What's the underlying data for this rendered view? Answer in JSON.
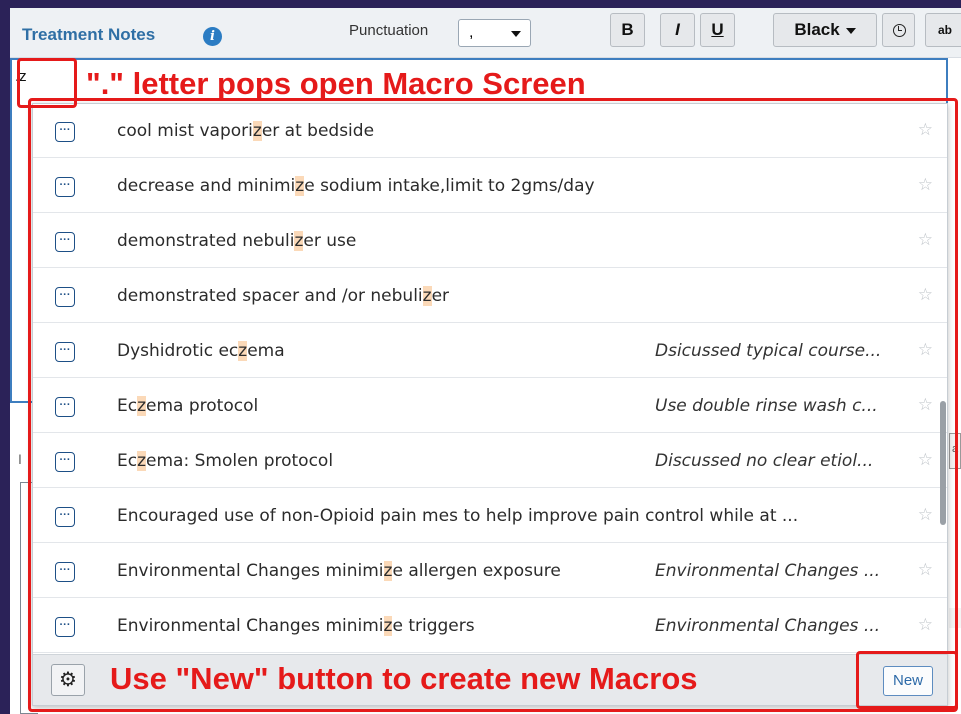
{
  "toolbar": {
    "title": "Treatment Notes",
    "punctuation_label": "Punctuation",
    "punctuation_value": ",",
    "bold_label": "B",
    "italic_label": "I",
    "underline_label": "U",
    "color_label": "Black",
    "spell_label": "ab"
  },
  "editor": {
    "input_value": ".z"
  },
  "under_field": {
    "label": "I",
    "side_mark": "a"
  },
  "macros": [
    {
      "title": [
        "cool mist vapori",
        "z",
        "er at bedside"
      ],
      "desc": ""
    },
    {
      "title": [
        "decrease and minimi",
        "z",
        "e sodium intake,limit to 2gms/day"
      ],
      "desc": ""
    },
    {
      "title": [
        "demonstrated nebuli",
        "z",
        "er use"
      ],
      "desc": ""
    },
    {
      "title": [
        "demonstrated spacer and /or nebuli",
        "z",
        "er"
      ],
      "desc": ""
    },
    {
      "title": [
        "Dyshidrotic ec",
        "z",
        "ema"
      ],
      "desc": "Dsicussed typical course..."
    },
    {
      "title": [
        "Ec",
        "z",
        "ema protocol"
      ],
      "desc": "Use double rinse wash c..."
    },
    {
      "title": [
        "Ec",
        "z",
        "ema: Smolen protocol"
      ],
      "desc": "Discussed no clear etiol..."
    },
    {
      "title": [
        "Encouraged use of non-Opioid pain mes to help improve pain control while at ...",
        "",
        ""
      ],
      "desc": ""
    },
    {
      "title": [
        "Environmental Changes minimi",
        "z",
        "e allergen exposure"
      ],
      "desc": "Environmental Changes ..."
    },
    {
      "title": [
        "Environmental Changes minimi",
        "z",
        "e triggers"
      ],
      "desc": "Environmental Changes ..."
    }
  ],
  "footer": {
    "new_label": "New"
  },
  "annotations": {
    "top": "\".\" letter pops open Macro Screen",
    "bottom": "Use \"New\" button to create new Macros",
    "color": "#e51a1a"
  },
  "icons": {
    "info": "info-icon",
    "clock": "clock-icon",
    "macro_row": "ellipsis-box-icon",
    "star": "star-outline-icon",
    "gear": "gear-icon"
  }
}
